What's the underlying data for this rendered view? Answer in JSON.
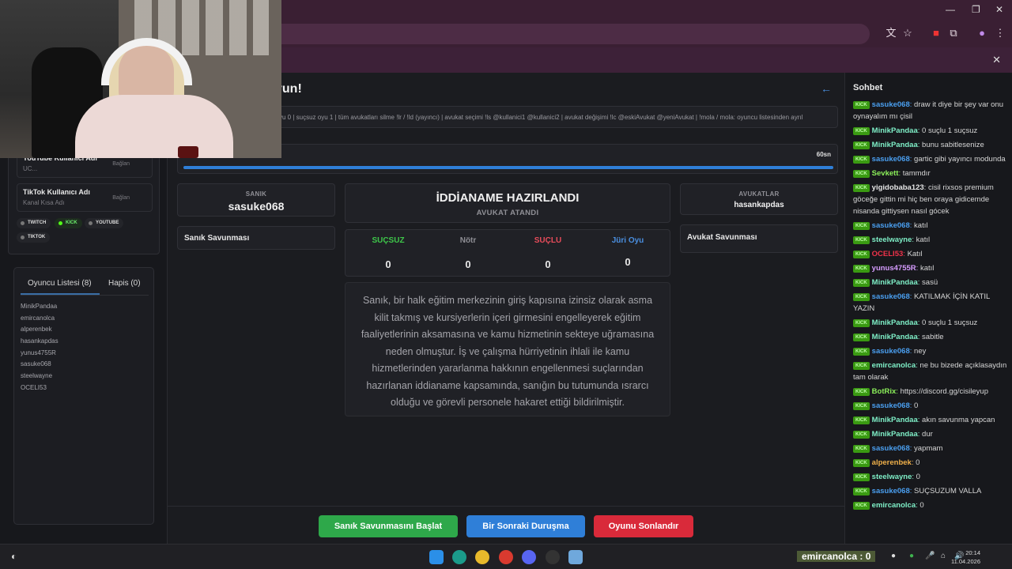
{
  "sidebar": {
    "youtube": {
      "title": "YouTube Kullanıcı Adı",
      "placeholder": "UC...",
      "connect": "Bağlan"
    },
    "tiktok": {
      "title": "TikTok Kullanıcı Adı",
      "placeholder": "Kanal Kısa Adı",
      "connect": "Bağlan"
    },
    "platforms": [
      "TWITCH",
      "KICK",
      "YOUTUBE",
      "TIKTOK"
    ],
    "tabs": {
      "players": "Oyuncu Listesi (8)",
      "jail": "Hapis (0)"
    },
    "players": [
      "MinikPandaa",
      "emircanolca",
      "alperenbek",
      "hasankapdas",
      "yunus4755R",
      "sasuke068",
      "steelwayne",
      "OCELI53"
    ]
  },
  "main": {
    "title_fragment": "vun!",
    "commands": "yu 0 | suçsuz oyu 1 | tüm avukatları silme !lr / !ld (yayıncı) | avukat seçimi !ls @kullanici1 @kullanici2 | avukat değişimi !lc @eskiAvukat @yeniAvukat | !mola / mola: oyuncu listesinden ayrıl",
    "timer": "60sn",
    "timer_progress": 1.0,
    "defendant": {
      "label": "SANIK",
      "name": "sasuke068",
      "defense": "Sanık Savunması"
    },
    "status": {
      "title": "İDDİANAME HAZIRLANDI",
      "subtitle": "AVUKAT ATANDI"
    },
    "lawyers": {
      "label": "AVUKATLAR",
      "name": "hasankapdas",
      "defense": "Avukat Savunması"
    },
    "votes": [
      {
        "label": "SUÇSUZ",
        "count": "0",
        "color": "#3ec74a"
      },
      {
        "label": "Nötr",
        "count": "0",
        "color": "#8e8e94"
      },
      {
        "label": "SUÇLU",
        "count": "0",
        "color": "#e84c5a"
      },
      {
        "label": "Jüri Oyu",
        "count": "0",
        "color": "#4a8fe0"
      }
    ],
    "indictment": "Sanık, bir halk eğitim merkezinin giriş kapısına izinsiz olarak asma kilit takmış ve kursiyerlerin içeri girmesini engelleyerek eğitim faaliyetlerinin aksamasına ve kamu hizmetinin sekteye uğramasına neden olmuştur. İş ve çalışma hürriyetinin ihlali ile kamu hizmetlerinden yararlanma hakkının engellenmesi suçlarından hazırlanan iddianame kapsamında, sanığın bu tutumunda ısrarcı olduğu ve görevli personele hakaret ettiği bildirilmiştir.",
    "buttons": {
      "start_defense": "Sanık Savunmasını Başlat",
      "next_trial": "Bir Sonraki Duruşma",
      "end_game": "Oyunu Sonlandır"
    }
  },
  "chat": {
    "title": "Sohbet",
    "badge": "KICK",
    "messages": [
      {
        "user": "sasuke068",
        "color": "#4a9ff0",
        "text": "draw it diye bir şey var onu oynayalım mı çisil"
      },
      {
        "user": "MinikPandaa",
        "color": "#7ff0c8",
        "text": "0 suçlu 1 suçsuz"
      },
      {
        "user": "MinikPandaa",
        "color": "#7ff0c8",
        "text": "bunu sabitlesenize"
      },
      {
        "user": "sasuke068",
        "color": "#4a9ff0",
        "text": "gartic gibi yayıncı modunda"
      },
      {
        "user": "Sevkett",
        "color": "#8cf05a",
        "text": "tammdır"
      },
      {
        "user": "yigidobaba123",
        "color": "#e6e6e6",
        "text": "cisil rixsos premium göceğe gittin mi hiç ben oraya gidicemde nisanda gittiysen nasıl gócek"
      },
      {
        "user": "sasuke068",
        "color": "#4a9ff0",
        "text": "katıl"
      },
      {
        "user": "steelwayne",
        "color": "#7ff0c8",
        "text": "katıl"
      },
      {
        "user": "OCELI53",
        "color": "#f0324a",
        "text": "Katıl"
      },
      {
        "user": "yunus4755R",
        "color": "#d69cff",
        "text": "katıl"
      },
      {
        "user": "MinikPandaa",
        "color": "#7ff0c8",
        "text": "sasü"
      },
      {
        "user": "sasuke068",
        "color": "#4a9ff0",
        "text": "KATILMAK İÇİN KATIL YAZIN"
      },
      {
        "user": "MinikPandaa",
        "color": "#7ff0c8",
        "text": "0 suçlu 1 suçsuz"
      },
      {
        "user": "MinikPandaa",
        "color": "#7ff0c8",
        "text": "sabitle"
      },
      {
        "user": "sasuke068",
        "color": "#4a9ff0",
        "text": "ney"
      },
      {
        "user": "emircanolca",
        "color": "#7ff0c8",
        "text": "ne bu bizede açıklasaydın tam olarak"
      },
      {
        "user": "BotRix",
        "color": "#8cf05a",
        "text": "https://discord.gg/cisileyup"
      },
      {
        "user": "sasuke068",
        "color": "#4a9ff0",
        "text": "0"
      },
      {
        "user": "MinikPandaa",
        "color": "#7ff0c8",
        "text": "akın savunma yapcan"
      },
      {
        "user": "MinikPandaa",
        "color": "#7ff0c8",
        "text": "dur"
      },
      {
        "user": "sasuke068",
        "color": "#4a9ff0",
        "text": "yapmam"
      },
      {
        "user": "alperenbek",
        "color": "#f0b04a",
        "text": "0"
      },
      {
        "user": "steelwayne",
        "color": "#7ff0c8",
        "text": "0"
      },
      {
        "user": "sasuke068",
        "color": "#4a9ff0",
        "text": "SUÇSUZUM VALLA"
      },
      {
        "user": "emircanolca",
        "color": "#7ff0c8",
        "text": "0"
      }
    ]
  },
  "taskbar": {
    "overlay": "emircanolca : 0",
    "time": "20:14",
    "date": "11.04.2026"
  }
}
